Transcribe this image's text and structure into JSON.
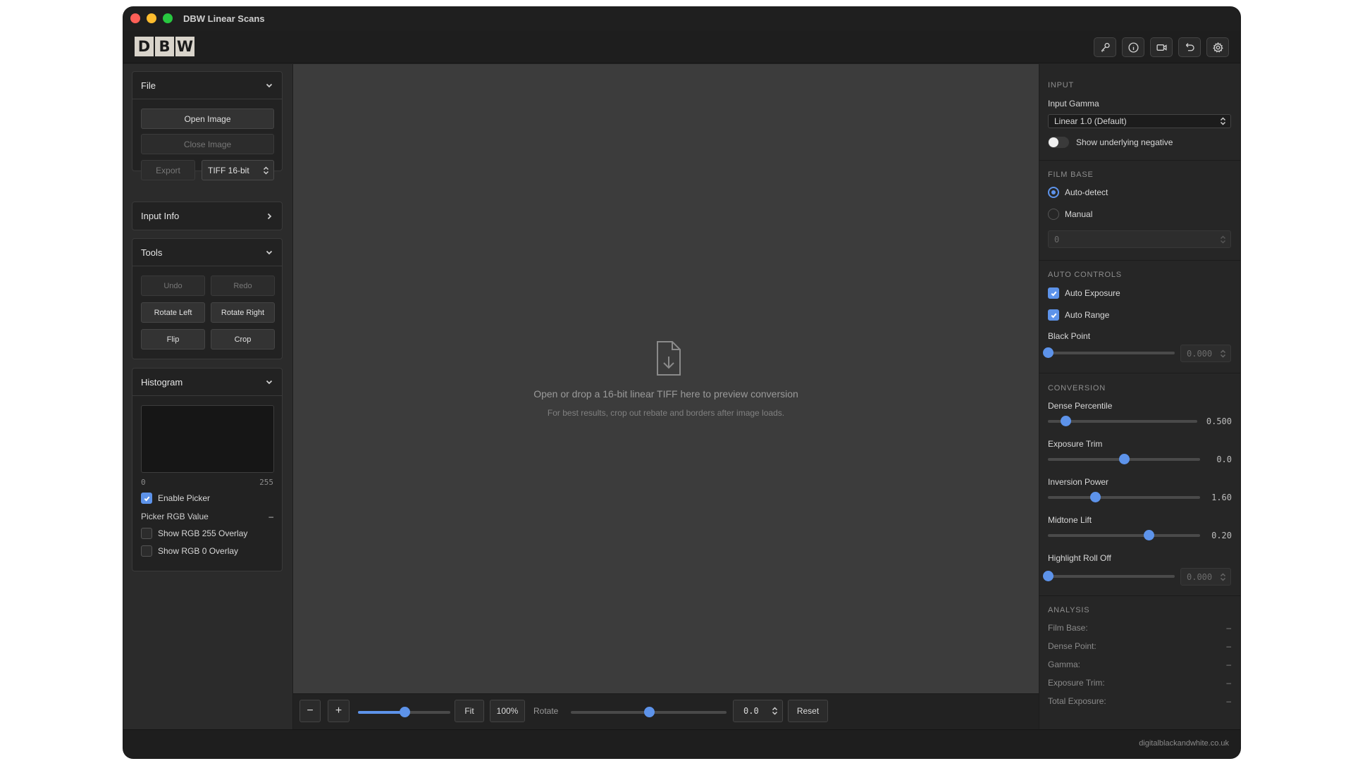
{
  "window": {
    "title": "DBW Linear Scans"
  },
  "logo": [
    "D",
    "B",
    "W"
  ],
  "header_icons": [
    "key-icon",
    "info-icon",
    "video-icon",
    "undo-icon",
    "gear-icon"
  ],
  "left": {
    "file": {
      "title": "File",
      "open": "Open Image",
      "close": "Close Image",
      "export": "Export",
      "format": "TIFF 16-bit"
    },
    "input_info": {
      "title": "Input Info"
    },
    "tools": {
      "title": "Tools",
      "undo": "Undo",
      "redo": "Redo",
      "rotate_left": "Rotate Left",
      "rotate_right": "Rotate Right",
      "flip": "Flip",
      "crop": "Crop"
    },
    "histogram": {
      "title": "Histogram",
      "min": "0",
      "max": "255",
      "enable_picker": "Enable Picker",
      "enable_picker_checked": true,
      "picker_rgb_label": "Picker RGB Value",
      "picker_rgb_value": "–",
      "show_255": "Show RGB 255 Overlay",
      "show_255_checked": false,
      "show_0": "Show RGB 0 Overlay",
      "show_0_checked": false
    }
  },
  "canvas": {
    "message": "Open or drop a 16-bit linear TIFF here to preview conversion",
    "hint": "For best results, crop out rebate and borders after image loads."
  },
  "bottombar": {
    "zoom_out": "−",
    "zoom_in": "+",
    "zoom_level": 0.5,
    "fit": "Fit",
    "hundred": "100%",
    "rotate_label": "Rotate",
    "rotate_level": 0.5,
    "rotate_value": "0.0",
    "reset": "Reset"
  },
  "right": {
    "input": {
      "title": "INPUT",
      "gamma_label": "Input Gamma",
      "gamma_value": "Linear 1.0 (Default)",
      "show_negative": "Show underlying negative",
      "show_negative_on": false
    },
    "film_base": {
      "title": "FILM BASE",
      "auto": "Auto-detect",
      "manual": "Manual",
      "selected": "Auto-detect",
      "manual_value": "0"
    },
    "auto_controls": {
      "title": "AUTO CONTROLS",
      "auto_exposure": "Auto Exposure",
      "auto_exposure_checked": true,
      "auto_range": "Auto Range",
      "auto_range_checked": true,
      "black_point_label": "Black Point",
      "black_point_value": "0.000",
      "black_point_level": 0
    },
    "conversion": {
      "title": "CONVERSION",
      "dense_percentile_label": "Dense Percentile",
      "dense_percentile_value": "0.500",
      "dense_percentile_level": 0.12,
      "exposure_trim_label": "Exposure Trim",
      "exposure_trim_value": "0.0",
      "exposure_trim_level": 0.5,
      "inversion_power_label": "Inversion Power",
      "inversion_power_value": "1.60",
      "inversion_power_level": 0.31,
      "midtone_lift_label": "Midtone Lift",
      "midtone_lift_value": "0.20",
      "midtone_lift_level": 0.66,
      "highlight_rolloff_label": "Highlight Roll Off",
      "highlight_rolloff_value": "0.000",
      "highlight_rolloff_level": 0
    },
    "analysis": {
      "title": "ANALYSIS",
      "rows": [
        {
          "label": "Film Base:",
          "value": "–"
        },
        {
          "label": "Dense Point:",
          "value": "–"
        },
        {
          "label": "Gamma:",
          "value": "–"
        },
        {
          "label": "Exposure Trim:",
          "value": "–"
        },
        {
          "label": "Total Exposure:",
          "value": "–"
        }
      ]
    }
  },
  "footer": {
    "url": "digitalblackandwhite.co.uk"
  },
  "colors": {
    "accent": "#5d93ea",
    "window_bg": "#262626",
    "canvas_bg": "#3c3c3c"
  }
}
